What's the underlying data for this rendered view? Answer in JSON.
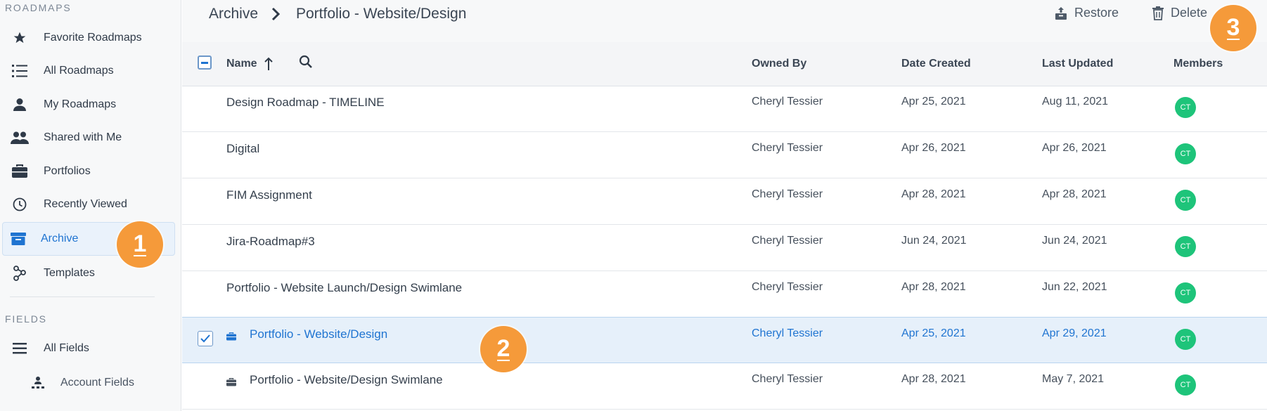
{
  "sidebar": {
    "sections": [
      {
        "title": "ROADMAPS",
        "items": [
          {
            "label": "Favorite Roadmaps",
            "icon": "star-icon"
          },
          {
            "label": "All Roadmaps",
            "icon": "list-icon"
          },
          {
            "label": "My Roadmaps",
            "icon": "user-icon"
          },
          {
            "label": "Shared with Me",
            "icon": "users-icon"
          },
          {
            "label": "Portfolios",
            "icon": "briefcase-icon"
          },
          {
            "label": "Recently Viewed",
            "icon": "clock-icon"
          },
          {
            "label": "Archive",
            "icon": "archive-icon",
            "active": true
          },
          {
            "label": "Templates",
            "icon": "templates-icon"
          }
        ]
      },
      {
        "title": "FIELDS",
        "items": [
          {
            "label": "All Fields",
            "icon": "fields-icon"
          },
          {
            "label": "Account Fields",
            "icon": "account-fields-icon"
          }
        ]
      }
    ]
  },
  "header": {
    "breadcrumb": [
      "Archive",
      "Portfolio - Website/Design"
    ],
    "actions": [
      {
        "label": "Restore",
        "icon": "restore-icon"
      },
      {
        "label": "Delete",
        "icon": "trash-icon"
      }
    ]
  },
  "table": {
    "columns": [
      "Name",
      "Owned By",
      "Date Created",
      "Last Updated",
      "Members"
    ],
    "rows": [
      {
        "name": "Design Roadmap - TIMELINE",
        "owner": "Cheryl Tessier",
        "created": "Apr 25, 2021",
        "updated": "Aug 11, 2021",
        "member": "CT"
      },
      {
        "name": "Digital",
        "owner": "Cheryl Tessier",
        "created": "Apr 26, 2021",
        "updated": "Apr 26, 2021",
        "member": "CT"
      },
      {
        "name": "FIM Assignment",
        "owner": "Cheryl Tessier",
        "created": "Apr 28, 2021",
        "updated": "Apr 28, 2021",
        "member": "CT"
      },
      {
        "name": "Jira-Roadmap#3",
        "owner": "Cheryl Tessier",
        "created": "Jun 24, 2021",
        "updated": "Jun 24, 2021",
        "member": "CT"
      },
      {
        "name": "Portfolio - Website Launch/Design Swimlane",
        "owner": "Cheryl Tessier",
        "created": "Apr 28, 2021",
        "updated": "Jun 22, 2021",
        "member": "CT"
      },
      {
        "name": "Portfolio - Website/Design",
        "owner": "Cheryl Tessier",
        "created": "Apr 25, 2021",
        "updated": "Apr 29, 2021",
        "member": "CT",
        "selected": true,
        "portfolio": true
      },
      {
        "name": "Portfolio - Website/Design Swimlane",
        "owner": "Cheryl Tessier",
        "created": "Apr 28, 2021",
        "updated": "May 7, 2021",
        "member": "CT",
        "portfolio": true
      }
    ]
  },
  "annotations": [
    "1",
    "2",
    "3"
  ],
  "colors": {
    "accent": "#1f74d1",
    "badge": "#f59a3a",
    "avatar": "#1ec47a",
    "selected_row": "#e6f0fa"
  }
}
